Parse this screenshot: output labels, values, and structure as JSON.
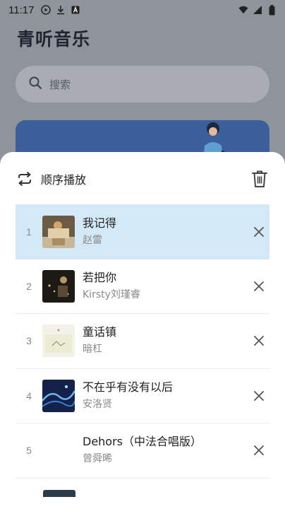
{
  "status_bar": {
    "time": "11:17",
    "icons": [
      "play-circle-icon",
      "download-icon",
      "app-a-icon"
    ],
    "right_icons": [
      "wifi-icon",
      "signal-icon",
      "battery-icon"
    ]
  },
  "app": {
    "title": "青听音乐",
    "search": {
      "placeholder": "搜索"
    }
  },
  "sheet": {
    "mode_label": "顺序播放",
    "mode_icon": "repeat-icon",
    "clear_icon": "trash-icon",
    "songs": [
      {
        "index": "1",
        "title": "我记得",
        "artist": "赵雷",
        "active": true,
        "cover": "cover-1"
      },
      {
        "index": "2",
        "title": "若把你",
        "artist": "Kirsty刘瑾睿",
        "active": false,
        "cover": "cover-2"
      },
      {
        "index": "3",
        "title": "童话镇",
        "artist": "暗杠",
        "active": false,
        "cover": "cover-3"
      },
      {
        "index": "4",
        "title": "不在乎有没有以后",
        "artist": "安洛贤",
        "active": false,
        "cover": "cover-4"
      },
      {
        "index": "5",
        "title": "Dehors（中法合唱版）",
        "artist": "曾舜晞",
        "active": false,
        "cover": "none"
      }
    ]
  },
  "colors": {
    "active_row": "#d4e9f7",
    "overlay": "#8f949b"
  }
}
